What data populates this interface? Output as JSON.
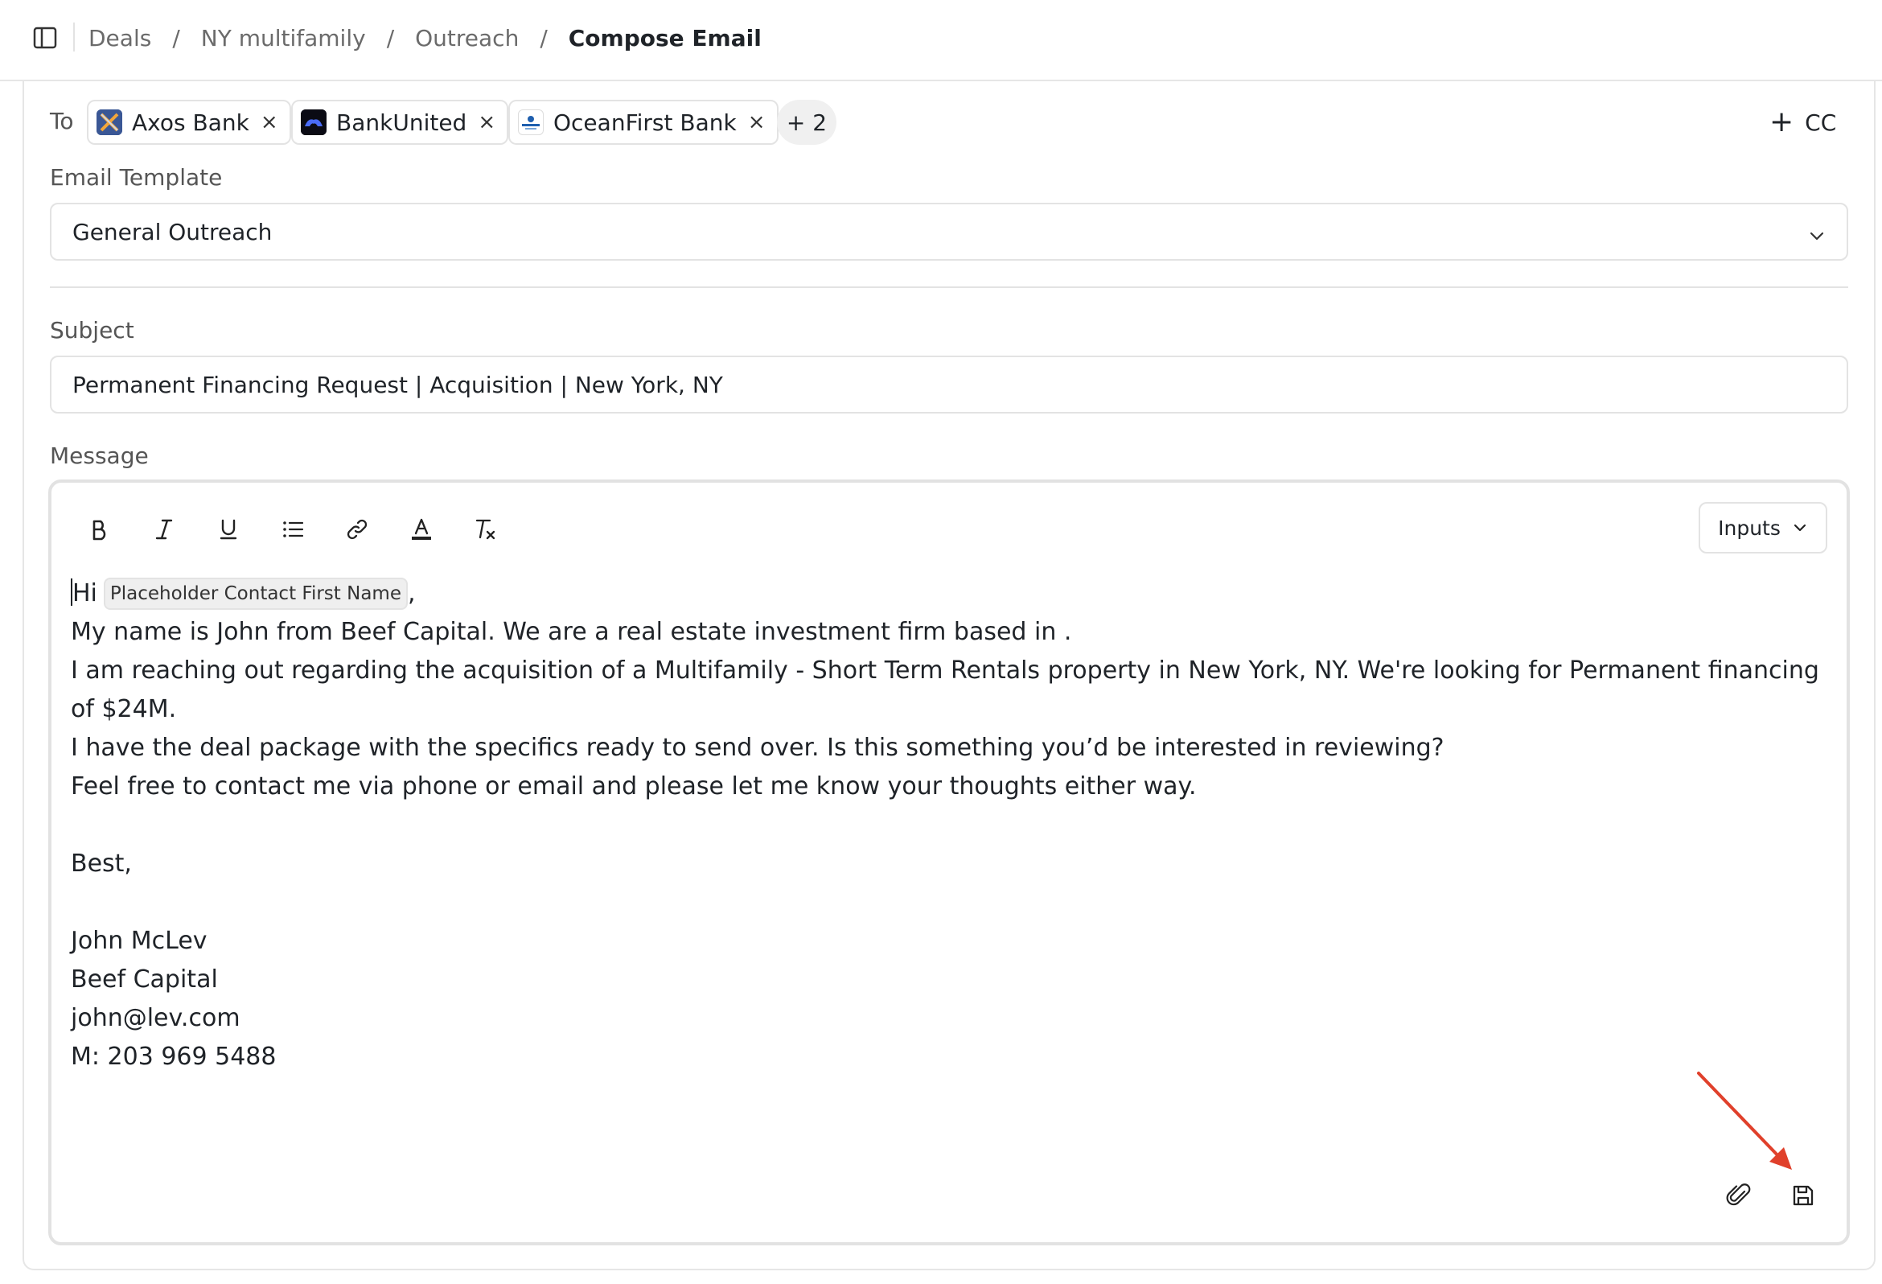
{
  "breadcrumb": {
    "items": [
      "Deals",
      "NY multifamily",
      "Outreach"
    ],
    "current": "Compose Email",
    "separator": "/"
  },
  "recipients": {
    "label": "To",
    "chips": [
      {
        "name": "Axos Bank",
        "logo": "axos-bank-logo"
      },
      {
        "name": "BankUnited",
        "logo": "bankunited-logo"
      },
      {
        "name": "OceanFirst Bank",
        "logo": "oceanfirst-bank-logo"
      }
    ],
    "remove_glyph": "×",
    "more": "+ 2",
    "cc_label": "CC",
    "cc_glyph": "+"
  },
  "template": {
    "label": "Email Template",
    "value": "General Outreach",
    "icon": "chevron-down-icon"
  },
  "subject": {
    "label": "Subject",
    "value": "Permanent Financing Request | Acquisition | New York, NY"
  },
  "message": {
    "label": "Message",
    "toolbar": [
      "bold-icon",
      "italic-icon",
      "underline-icon",
      "bullet-list-icon",
      "link-icon",
      "text-color-icon",
      "clear-format-icon"
    ],
    "inputs_label": "Inputs",
    "greeting": "Hi",
    "placeholder_var": "Placeholder Contact First Name",
    "greeting_suffix": ",",
    "lines": [
      "My name is John from Beef Capital. We are a real estate investment firm based in .",
      "I am reaching out regarding the acquisition of a Multifamily - Short Term Rentals property in New York, NY. We're looking for Permanent financing of $24M.",
      "I have the deal package with the specifics ready to send over. Is this something you’d be interested in reviewing?",
      "Feel free to contact me via phone or email and please let me know your thoughts either way."
    ],
    "signoff": "Best,",
    "signature": [
      "John McLev",
      "Beef Capital",
      "john@lev.com",
      "M: 203 969 5488"
    ],
    "footer_icons": [
      "paperclip-icon",
      "save-icon"
    ]
  },
  "colors": {
    "annotation_arrow": "#e0402b",
    "border": "#e3e3e3",
    "text": "#1f2328",
    "muted": "#555555"
  }
}
